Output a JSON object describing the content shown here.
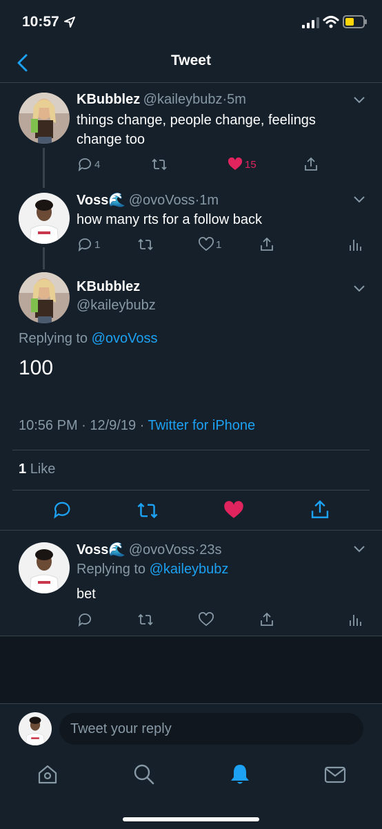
{
  "status": {
    "time": "10:57"
  },
  "nav": {
    "title": "Tweet"
  },
  "tweets": {
    "t1": {
      "name": "KBubblez",
      "handle": "@kaileybubz",
      "sep": "·",
      "time": "5m",
      "text": "things change, people change, feelings change too",
      "replies": "4",
      "likes": "15"
    },
    "t2": {
      "name": "Voss🌊",
      "handle": "@ovoVoss",
      "sep": "·",
      "time": "1m",
      "text": "how many rts for a follow back",
      "replies": "1",
      "likes": "1"
    },
    "main": {
      "name": "KBubblez",
      "handle": "@kaileybubz",
      "replying_label": "Replying to",
      "replying_to": "@ovoVoss",
      "text": "100",
      "timestamp": "10:56 PM · 12/9/19 ·",
      "source": "Twitter for iPhone",
      "like_count": "1",
      "like_label": "Like"
    },
    "t3": {
      "name": "Voss🌊",
      "handle": "@ovoVoss",
      "sep": "·",
      "time": "23s",
      "replying_label": "Replying to",
      "replying_to": "@kaileybubz",
      "text": "bet"
    }
  },
  "compose": {
    "placeholder": "Tweet your reply"
  },
  "colors": {
    "background": "#15202b",
    "accent": "#1da1f2",
    "like": "#e0245e",
    "secondary": "#8899a6",
    "divider": "#38444d"
  },
  "tabs": [
    "home-icon",
    "search-icon",
    "notifications-icon",
    "messages-icon"
  ]
}
